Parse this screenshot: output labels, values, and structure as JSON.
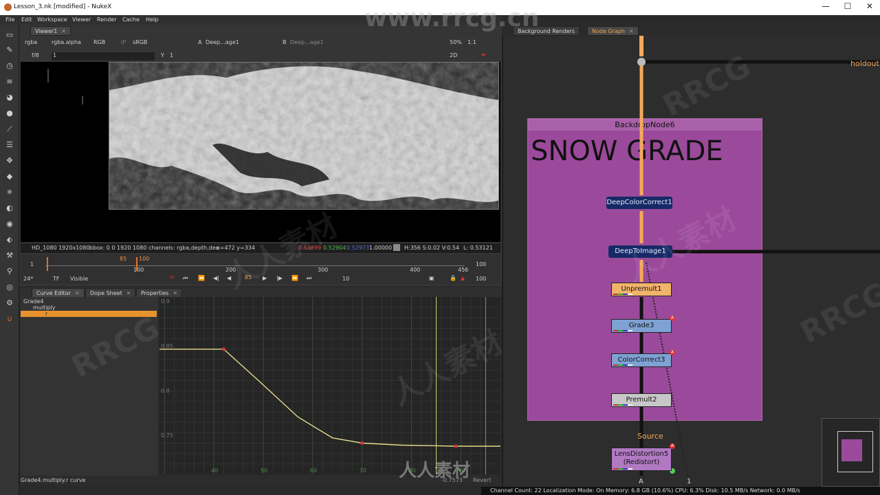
{
  "window": {
    "title": "Lesson_3.nk [modified] - NukeX",
    "minimize": "—",
    "maximize": "☐",
    "close": "✕"
  },
  "menu": [
    "File",
    "Edit",
    "Workspace",
    "Viewer",
    "Render",
    "Cache",
    "Help"
  ],
  "viewer": {
    "tab": "Viewer1",
    "controls": {
      "channels": "rgba",
      "alpha": "rgba.alpha",
      "rgb": "RGB",
      "ip": "IP",
      "colorspace": "sRGB",
      "input_a": "A",
      "input_a_node": "Deep...age1",
      "input_b": "B",
      "input_b_node": "Deep...age1",
      "zoom": "50%",
      "ratio": "1:1",
      "fstop": "f/8",
      "y_label": "Y",
      "y_value": "1",
      "frame_field": "1",
      "mode": "2D"
    },
    "info": {
      "format": "HD_1080 1920x1080",
      "bbox": "bbox: 0 0 1920 1080",
      "channels": "channels: rgba,depth,dee",
      "coords": "x=472 y=334",
      "r": "0.53899",
      "g": "0.52904",
      "b": "0.52973",
      "a": "1.00000",
      "hsv": "H:356 S:0.02 V:0.54",
      "lum": "L: 0.53121"
    },
    "timeline": {
      "start": "1",
      "ticks": [
        "100",
        "200",
        "300",
        "400",
        "456"
      ],
      "marker_in": "85",
      "marker_out": "100",
      "end_field": "100"
    },
    "transport": {
      "fps": "24*",
      "tf": "TF",
      "visible": "Visible",
      "frame": "85",
      "step": "10",
      "end": "100"
    }
  },
  "lower_tabs": [
    "Curve Editor",
    "Dope Sheet",
    "Properties"
  ],
  "curve_editor": {
    "tree": [
      "Grade4",
      "multiply",
      "r"
    ],
    "y_ticks": [
      "0.9",
      "0.85",
      "0.8",
      "0.75"
    ],
    "x_ticks": [
      "40",
      "50",
      "60",
      "70",
      "80",
      "90"
    ],
    "status_path": "Grade4.multiply.r",
    "status_expr": "curve",
    "readout": "-0.7573",
    "revert": "Revert"
  },
  "chart_data": {
    "type": "line",
    "title": "",
    "xlabel": "",
    "ylabel": "",
    "xlim": [
      29,
      98
    ],
    "ylim": [
      0.73,
      0.9
    ],
    "series": [
      {
        "name": "",
        "x": [
          29,
          42,
          49,
          57,
          64,
          70,
          78,
          89,
          98
        ],
        "y": [
          0.85,
          0.85,
          0.82,
          0.785,
          0.765,
          0.76,
          0.758,
          0.757,
          0.757
        ]
      }
    ],
    "keyframes": [
      {
        "x": 42,
        "y": 0.85
      },
      {
        "x": 70,
        "y": 0.76
      },
      {
        "x": 89,
        "y": 0.757
      }
    ],
    "grid": true
  },
  "node_graph": {
    "tabs": [
      "Background Renders",
      "Node Graph"
    ],
    "backdrop_title": "BackdropNode6",
    "backdrop_label": "SNOW GRADE",
    "nodes": {
      "deepcolorcorrect": "DeepColorCorrect1",
      "deeptoimage": "DeepToImage1",
      "unpremult": "Unpremult1",
      "grade": "Grade3",
      "colorcorrect": "ColorCorrect3",
      "premult": "Premult2",
      "source": "Source",
      "lensdistortion": "LensDistortion5",
      "lensdistortion_sub": "(Redistort)",
      "holdout": "holdout",
      "input_a": "A",
      "input_1": "1"
    },
    "colors": {
      "pipe": "#f5a95a",
      "backdrop": "#9b4a9b",
      "deep_node": "#152a66",
      "grade_node": "#7fa2d4"
    }
  },
  "status": "Channel Count: 22 Localization Mode: On Memory: 6.8 GB (10.6%) CPU: 6.3% Disk: 10.5 MB/s Network: 0.0 MB/s",
  "watermarks": [
    "www.rrcg.cn",
    "RRCG",
    "人人素材"
  ]
}
